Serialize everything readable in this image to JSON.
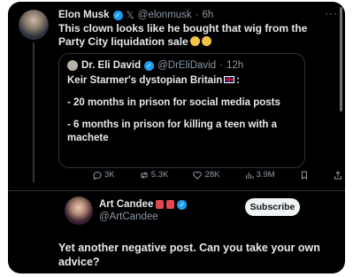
{
  "main_post": {
    "author_name": "Elon Musk",
    "handle": "@elonmusk",
    "time": "6h",
    "text": "This clown looks like he bought that wig from the Party City liquidation sale",
    "more": "···"
  },
  "quoted_post": {
    "author_name": "Dr. Eli David",
    "handle": "@DrEliDavid",
    "time": "12h",
    "line1": "Keir Starmer's dystopian Britain",
    "line1_suffix": ":",
    "line2": "- 20 months in prison for social media posts",
    "line3": "- 6 months in prison for killing a teen with a machete"
  },
  "actions": {
    "replies": "3K",
    "reposts": "5.3K",
    "likes": "28K",
    "views": "3.9M"
  },
  "reply": {
    "author_name": "Art Candee",
    "handle": "@ArtCandee",
    "subscribe_label": "Subscribe",
    "text": "Yet another negative post. Can you take your own advice?"
  },
  "colors": {
    "background": "#000000",
    "verified": "#1d9bf0",
    "muted": "#8b98a5"
  }
}
